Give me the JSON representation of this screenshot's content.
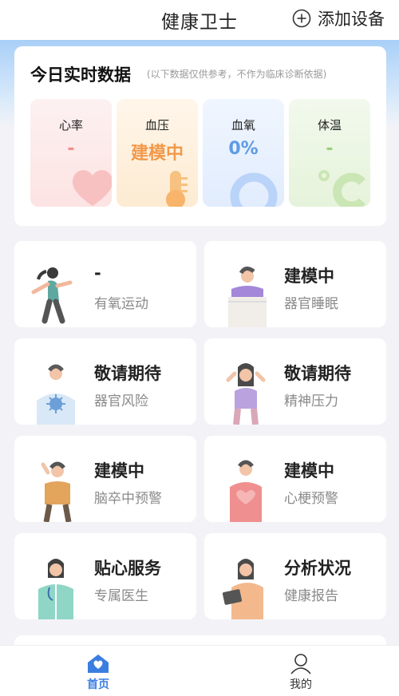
{
  "header": {
    "title": "健康卫士",
    "add_device_label": "添加设备"
  },
  "today": {
    "title": "今日实时数据",
    "note": "(以下数据仅供参考，不作为临床诊断依据)",
    "metrics": [
      {
        "label": "心率",
        "value": "-",
        "icon": "heart-icon",
        "color": "#f08d8d"
      },
      {
        "label": "血压",
        "value": "建模中",
        "icon": "thermometer-icon",
        "color": "#f2994a"
      },
      {
        "label": "血氧",
        "value": "0%",
        "icon": "ring-icon",
        "color": "#5e9be6"
      },
      {
        "label": "体温",
        "value": "-",
        "icon": "celsius-icon",
        "color": "#9ccf7a"
      }
    ]
  },
  "tiles": [
    {
      "title": "-",
      "subtitle": "有氧运动",
      "icon": "runner-figure"
    },
    {
      "title": "建模中",
      "subtitle": "器官睡眠",
      "icon": "sleeping-person-figure"
    },
    {
      "title": "敬请期待",
      "subtitle": "器官风险",
      "icon": "virus-person-figure"
    },
    {
      "title": "敬请期待",
      "subtitle": "精神压力",
      "icon": "stressed-person-figure"
    },
    {
      "title": "建模中",
      "subtitle": "脑卒中预警",
      "icon": "headache-person-figure"
    },
    {
      "title": "建模中",
      "subtitle": "心梗预警",
      "icon": "chest-pain-person-figure"
    },
    {
      "title": "贴心服务",
      "subtitle": "专属医生",
      "icon": "doctor-figure"
    },
    {
      "title": "分析状况",
      "subtitle": "健康报告",
      "icon": "tablet-person-figure"
    }
  ],
  "tabbar": {
    "home_label": "首页",
    "mine_label": "我的",
    "active_color": "#3b7ee0"
  }
}
